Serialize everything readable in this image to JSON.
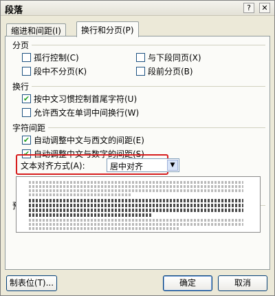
{
  "window": {
    "title": "段落",
    "help_btn": "?",
    "close_btn": "✕"
  },
  "tabs": [
    {
      "label": "缩进和间距(I)"
    },
    {
      "label": "换行和分页(P)"
    }
  ],
  "sections": {
    "pagination": {
      "label": "分页",
      "items": [
        {
          "label": "孤行控制(C)",
          "checked": false
        },
        {
          "label": "与下段同页(X)",
          "checked": false
        },
        {
          "label": "段中不分页(K)",
          "checked": false
        },
        {
          "label": "段前分页(B)",
          "checked": false
        }
      ]
    },
    "line_break": {
      "label": "换行",
      "items": [
        {
          "label": "按中文习惯控制首尾字符(U)",
          "checked": true
        },
        {
          "label": "允许西文在单词中间换行(W)",
          "checked": false
        }
      ]
    },
    "char_spacing": {
      "label": "字符间距",
      "items": [
        {
          "label": "自动调整中文与西文的间距(E)",
          "checked": true
        },
        {
          "label": "自动调整中文与数字的间距(S)",
          "checked": true
        }
      ],
      "text_alignment": {
        "label": "文本对齐方式(A):",
        "value": "居中对齐"
      }
    },
    "preview": {
      "label": "预览"
    }
  },
  "buttons": {
    "tabs": "制表位(T)...",
    "ok": "确定",
    "cancel": "取消"
  }
}
